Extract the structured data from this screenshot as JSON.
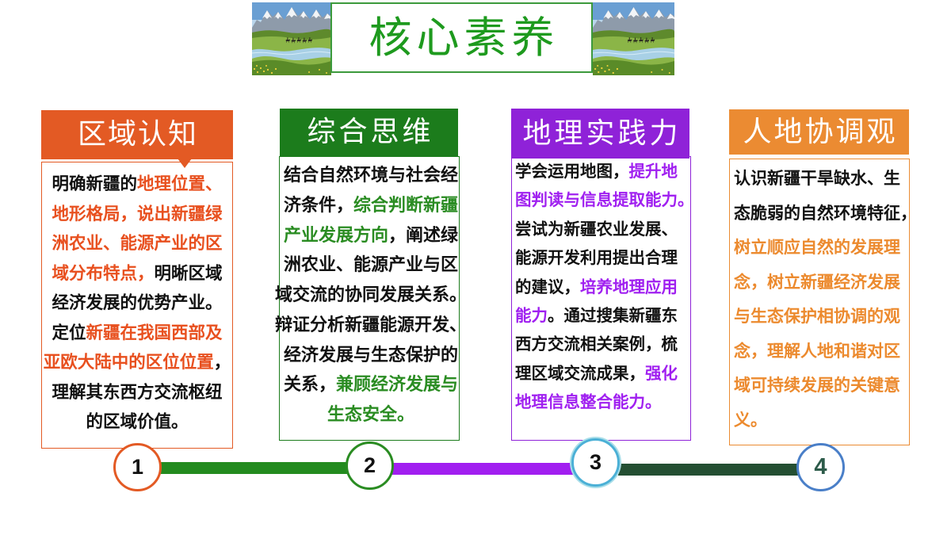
{
  "title": {
    "text": "核心素养",
    "color": "#1E9A1E",
    "border": "#3C9A3C"
  },
  "columns": [
    {
      "title": "区域认知",
      "accent": "#E35A24",
      "highlight": "#E8501F",
      "lines": [
        [
          {
            "text": "明确新疆的"
          },
          {
            "text": "地理位置、",
            "em": true
          }
        ],
        [
          {
            "text": "地形格局，说出新疆绿",
            "em": true
          }
        ],
        [
          {
            "text": "洲农业、能源产业的区",
            "em": true
          }
        ],
        [
          {
            "text": "域分布特点，",
            "em": true
          },
          {
            "text": "明晰区域"
          }
        ],
        [
          {
            "text": "经济发展的优势产业。"
          }
        ],
        [
          {
            "text": "定位"
          },
          {
            "text": "新疆在我国西部及",
            "em": true
          }
        ],
        [
          {
            "text": "亚欧大陆中的区位位置",
            "em": true
          },
          {
            "text": "，"
          }
        ],
        [
          {
            "text": "理解其东西方交流枢纽"
          }
        ],
        [
          {
            "text": "的区域价值。"
          }
        ]
      ]
    },
    {
      "title": "综合思维",
      "accent": "#1C7C1C",
      "highlight": "#2A8C22",
      "lines": [
        [
          {
            "text": "结合自然环境与社会经"
          }
        ],
        [
          {
            "text": "济条件，"
          },
          {
            "text": "综合判断新疆",
            "em": true
          }
        ],
        [
          {
            "text": "产业发展方向",
            "em": true
          },
          {
            "text": "，阐述绿"
          }
        ],
        [
          {
            "text": "洲农业、能源产业与区"
          }
        ],
        [
          {
            "text": "域交流的协同发展关系。"
          }
        ],
        [
          {
            "text": "辩证分析新疆能源开发、"
          }
        ],
        [
          {
            "text": "经济发展与生态保护的"
          }
        ],
        [
          {
            "text": "关系，"
          },
          {
            "text": "兼顾经济发展与",
            "em": true
          }
        ],
        [
          {
            "text": "生态安全。",
            "em": true
          }
        ]
      ]
    },
    {
      "title": "地理实践力",
      "accent": "#8F22D8",
      "highlight": "#A020F0",
      "lines": [
        [
          {
            "text": "学会运用地图，"
          },
          {
            "text": "提升地",
            "em": true
          }
        ],
        [
          {
            "text": "图判读与信息提取能力。",
            "em": true
          }
        ],
        [
          {
            "text": "尝试为新疆农业发展、"
          }
        ],
        [
          {
            "text": "能源开发利用提出合理"
          }
        ],
        [
          {
            "text": "的建议，"
          },
          {
            "text": "培养地理应用",
            "em": true
          }
        ],
        [
          {
            "text": "能力",
            "em": true
          },
          {
            "text": "。通过搜集新疆东"
          }
        ],
        [
          {
            "text": "西方交流相关案例，梳"
          }
        ],
        [
          {
            "text": "理区域交流成果，"
          },
          {
            "text": "强化",
            "em": true
          }
        ],
        [
          {
            "text": "地理信息整合能力。",
            "em": true
          }
        ]
      ]
    },
    {
      "title": "人地协调观",
      "accent": "#EB8B32",
      "highlight": "#EC8A2E",
      "lines": [
        [
          {
            "text": "认识新疆干旱缺水、生"
          }
        ],
        [
          {
            "text": "态脆弱的自然环境特征，"
          }
        ],
        [
          {
            "text": "树立顺应自然的发展理",
            "em": true
          }
        ],
        [
          {
            "text": "念，树立新疆经济发展",
            "em": true
          }
        ],
        [
          {
            "text": "与生态保护相协调的观",
            "em": true
          }
        ],
        [
          {
            "text": "念，理解人地和谐对区",
            "em": true
          }
        ],
        [
          {
            "text": "域可持续发展的关键意",
            "em": true
          }
        ],
        [
          {
            "text": "义。",
            "em": true
          }
        ]
      ]
    }
  ],
  "timeline": {
    "markers": [
      {
        "label": "1",
        "ring": "#E35A24",
        "color": "#111111"
      },
      {
        "label": "2",
        "ring": "#2A8C22",
        "color": "#111111"
      },
      {
        "label": "3",
        "ring": "#4BB0D6",
        "color": "#111111"
      },
      {
        "label": "4",
        "ring": "#4A7FC8",
        "color": "#2D5B4A"
      }
    ],
    "connectors": [
      "#238B1F",
      "#A11EF0",
      "#244F32"
    ]
  }
}
